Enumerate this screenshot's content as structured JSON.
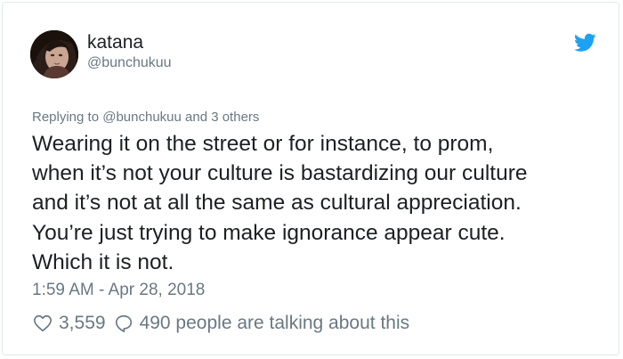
{
  "author": {
    "display_name": "katana",
    "handle": "@bunchukuu",
    "avatar_icon": "avatar-photo",
    "platform_icon": "twitter-bird-icon",
    "platform_color": "#1da1f2"
  },
  "reply": {
    "prefix": "Replying to",
    "mention": "@bunchukuu",
    "suffix": "and 3 others"
  },
  "tweet": {
    "text": "Wearing it on the street or for instance, to prom,\nwhen it’s not your culture is bastardizing our culture\nand it’s not at all the same as cultural appreciation.\nYou’re just trying to make ignorance appear cute.\nWhich it is not.",
    "timestamp": "1:59 AM - Apr 28, 2018"
  },
  "actions": {
    "like_icon": "heart-icon",
    "like_count": "3,559",
    "reply_icon": "speech-bubble-icon",
    "talking_text": "490 people are talking about this"
  }
}
